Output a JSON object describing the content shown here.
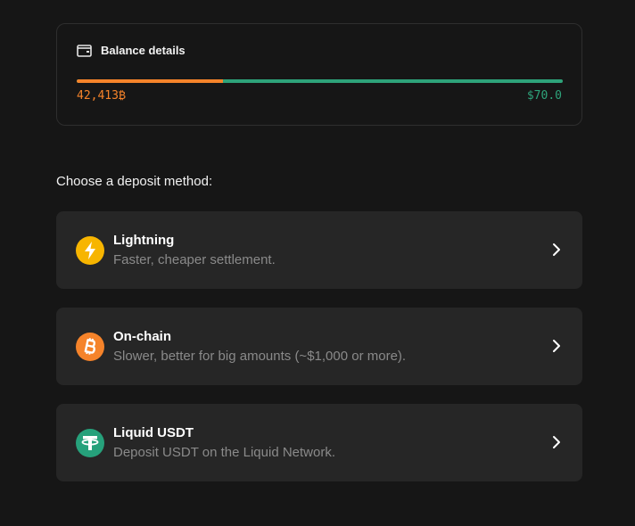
{
  "balance": {
    "title": "Balance details",
    "btc_amount": "42,413₿",
    "usd_amount": "$70.0",
    "btc_fraction": 0.3,
    "colors": {
      "btc": "#f5832a",
      "usd": "#2ea37a"
    }
  },
  "deposit": {
    "heading": "Choose a deposit method:",
    "methods": [
      {
        "title": "Lightning",
        "subtitle": "Faster, cheaper settlement.",
        "icon": "lightning-icon",
        "color": "#f7b500"
      },
      {
        "title": "On-chain",
        "subtitle": "Slower, better for big amounts (~$1,000 or more).",
        "icon": "bitcoin-icon",
        "color": "#f5832a"
      },
      {
        "title": "Liquid USDT",
        "subtitle": "Deposit USDT on the Liquid Network.",
        "icon": "tether-icon",
        "color": "#26a17b"
      }
    ]
  }
}
